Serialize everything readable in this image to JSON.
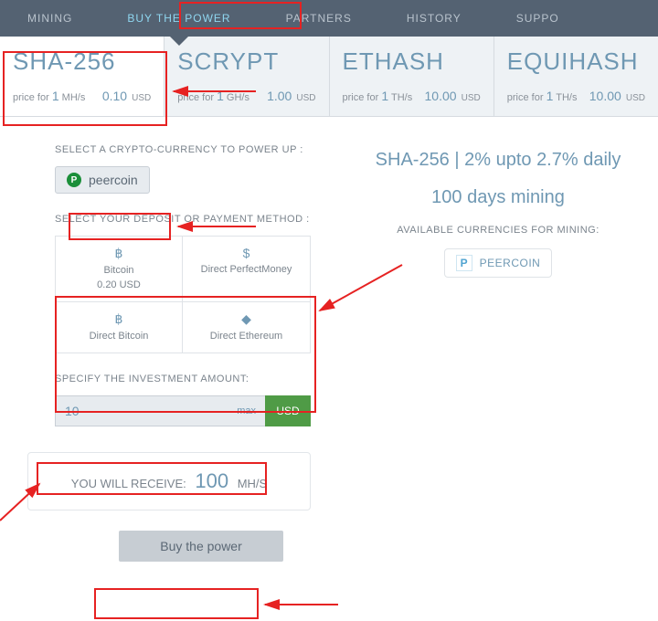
{
  "nav": {
    "items": [
      "MINING",
      "BUY THE POWER",
      "PARTNERS",
      "HISTORY",
      "SUPPO"
    ],
    "active_index": 1
  },
  "algos": [
    {
      "name": "SHA-256",
      "unit_label": "price for",
      "unit_qty": "1",
      "unit_unit": "MH/s",
      "price": "0.10",
      "currency": "USD"
    },
    {
      "name": "SCRYPT",
      "unit_label": "price for",
      "unit_qty": "1",
      "unit_unit": "GH/s",
      "price": "1.00",
      "currency": "USD"
    },
    {
      "name": "ETHASH",
      "unit_label": "price for",
      "unit_qty": "1",
      "unit_unit": "TH/s",
      "price": "10.00",
      "currency": "USD"
    },
    {
      "name": "EQUIHASH",
      "unit_label": "price for",
      "unit_qty": "1",
      "unit_unit": "TH/s",
      "price": "10.00",
      "currency": "USD"
    }
  ],
  "active_algo_index": 0,
  "labels": {
    "select_crypto": "SELECT A CRYPTO-CURRENCY TO POWER UP :",
    "select_payment": "SELECT YOUR DEPOSIT OR PAYMENT METHOD :",
    "specify_amount": "SPECIFY THE INVESTMENT AMOUNT:",
    "you_will_receive": "YOU WILL RECEIVE:",
    "receive_unit": "MH/S",
    "max": "max"
  },
  "crypto_selected": {
    "name": "peercoin",
    "icon_letter": "P"
  },
  "payment_methods": [
    {
      "icon": "฿",
      "name": "Bitcoin",
      "sub": "0.20 USD"
    },
    {
      "icon": "$",
      "name": "Direct PerfectMoney",
      "sub": ""
    },
    {
      "icon": "฿",
      "name": "Direct Bitcoin",
      "sub": ""
    },
    {
      "icon": "◆",
      "name": "Direct Ethereum",
      "sub": ""
    }
  ],
  "amount": {
    "value": "10",
    "unit": "USD"
  },
  "receive_value": "100",
  "buy_button": "Buy the power",
  "right": {
    "headline": "SHA-256 | 2% upto 2.7% daily",
    "subhead": "100 days mining",
    "avail_label": "AVAILABLE CURRENCIES FOR MINING:",
    "coin": {
      "letter": "P",
      "name": "PEERCOIN"
    }
  },
  "colors": {
    "accent": "#6f98b3",
    "nav_bg": "#546272",
    "highlight": "#e62222",
    "green": "#4f9b46"
  }
}
